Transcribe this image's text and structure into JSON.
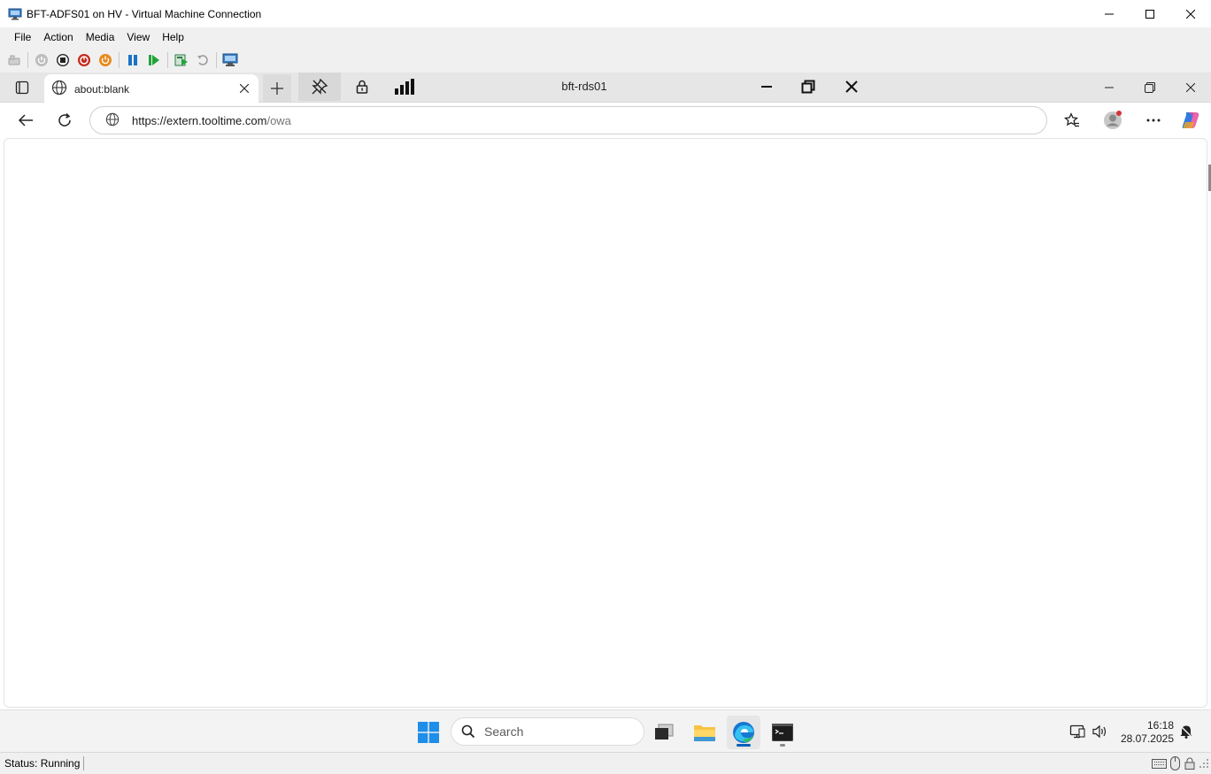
{
  "window": {
    "title": "BFT-ADFS01 on HV - Virtual Machine Connection",
    "icon": "vm-monitor-icon"
  },
  "menu": {
    "items": [
      "File",
      "Action",
      "Media",
      "View",
      "Help"
    ]
  },
  "toolbar": {
    "icons": [
      "ctrl-alt-del-icon",
      "start-icon",
      "turn-off-icon",
      "shutdown-icon",
      "save-icon",
      "pause-icon",
      "resume-icon",
      "checkpoint-icon",
      "revert-icon",
      "enhanced-session-icon"
    ]
  },
  "browser": {
    "tab_title": "about:blank",
    "url_host": "https://extern.tooltime.com",
    "url_path": "/owa"
  },
  "rdp_bar": {
    "title": "bft-rds01"
  },
  "taskbar": {
    "search_placeholder": "Search",
    "time": "16:18",
    "date": "28.07.2025"
  },
  "status": {
    "text": "Status: Running"
  },
  "colors": {
    "accent": "#005fb8",
    "stop_red": "#c42b1c",
    "shutdown_orange": "#e8891c",
    "resume_green": "#22a33a",
    "pause_blue": "#1a73c8"
  }
}
